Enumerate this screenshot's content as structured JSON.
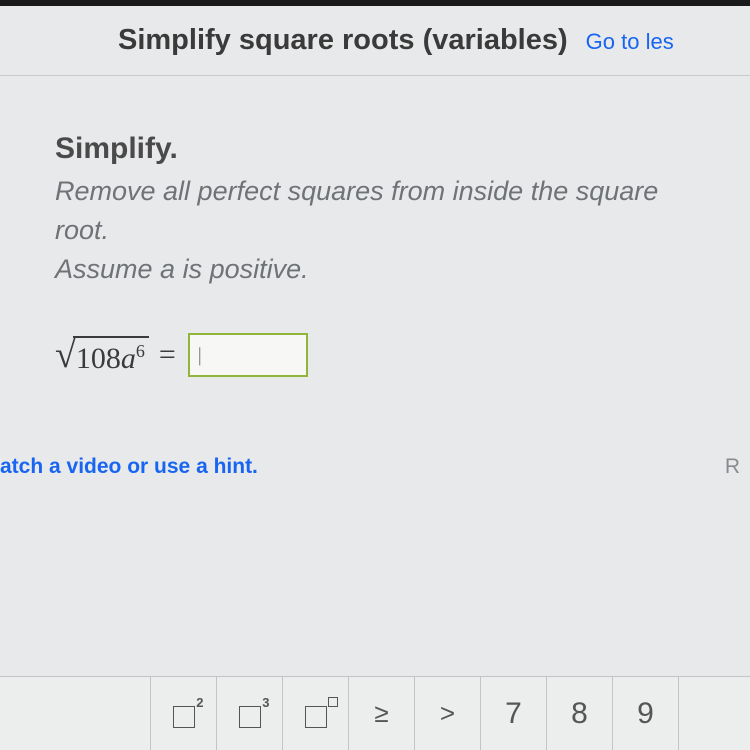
{
  "header": {
    "title": "Simplify square roots (variables)",
    "link_text": "Go to les"
  },
  "prompt": {
    "title": "Simplify.",
    "line1": "Remove all perfect squares from inside the square root.",
    "line2_prefix": "Assume ",
    "line2_var": "a",
    "line2_suffix": " is positive."
  },
  "expression": {
    "coefficient": "108",
    "variable": "a",
    "exponent": "6",
    "equals": "=",
    "input_value": "|"
  },
  "hint": {
    "watch_text": "atch a video or use a hint.",
    "report_text": "R"
  },
  "toolbar": {
    "sup2": "2",
    "sup3": "3",
    "gte": "≥",
    "gt": ">",
    "k7": "7",
    "k8": "8",
    "k9": "9"
  }
}
